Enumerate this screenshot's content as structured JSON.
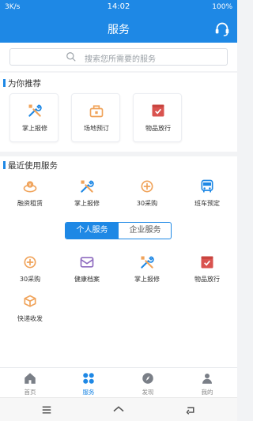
{
  "status_bar": {
    "left": "3K/s",
    "time": "14:02",
    "battery": "100%"
  },
  "header": {
    "title": "服务",
    "headset_icon": "headset-icon"
  },
  "search": {
    "placeholder": "搜索您所需要的服务"
  },
  "recommend": {
    "title": "为你推荐",
    "items": [
      {
        "label": "掌上报修",
        "icon": "repair-tools-icon",
        "color": "#1e88e5"
      },
      {
        "label": "场地预订",
        "icon": "venue-booking-icon",
        "color": "#f0a35a"
      },
      {
        "label": "物品放行",
        "icon": "goods-release-icon",
        "color": "#d9534f"
      }
    ]
  },
  "recent": {
    "title": "最近使用服务",
    "items": [
      {
        "label": "融资租赁",
        "icon": "finance-lease-icon",
        "color": "#f0a35a"
      },
      {
        "label": "掌上报修",
        "icon": "repair-tools-icon",
        "color": "#1e88e5"
      },
      {
        "label": "30采购",
        "icon": "purchase-icon",
        "color": "#f0a35a"
      },
      {
        "label": "班车预定",
        "icon": "shuttle-bus-icon",
        "color": "#1e88e5"
      }
    ]
  },
  "tabs": {
    "personal": "个人服务",
    "enterprise": "企业服务"
  },
  "personal_services": [
    {
      "label": "30采购",
      "icon": "purchase-icon",
      "color": "#f0a35a"
    },
    {
      "label": "健康档案",
      "icon": "health-record-icon",
      "color": "#8e6bbf"
    },
    {
      "label": "掌上报修",
      "icon": "repair-tools-icon",
      "color": "#1e88e5"
    },
    {
      "label": "物品放行",
      "icon": "goods-release-icon",
      "color": "#d9534f"
    },
    {
      "label": "快递收发",
      "icon": "express-delivery-icon",
      "color": "#f0a35a"
    }
  ],
  "bottom_nav": {
    "items": [
      {
        "label": "首页",
        "icon": "home-icon"
      },
      {
        "label": "服务",
        "icon": "services-icon"
      },
      {
        "label": "发现",
        "icon": "discover-icon"
      },
      {
        "label": "我的",
        "icon": "profile-icon"
      }
    ],
    "active_color": "#1e88e5",
    "inactive_color": "#7a7f87"
  }
}
